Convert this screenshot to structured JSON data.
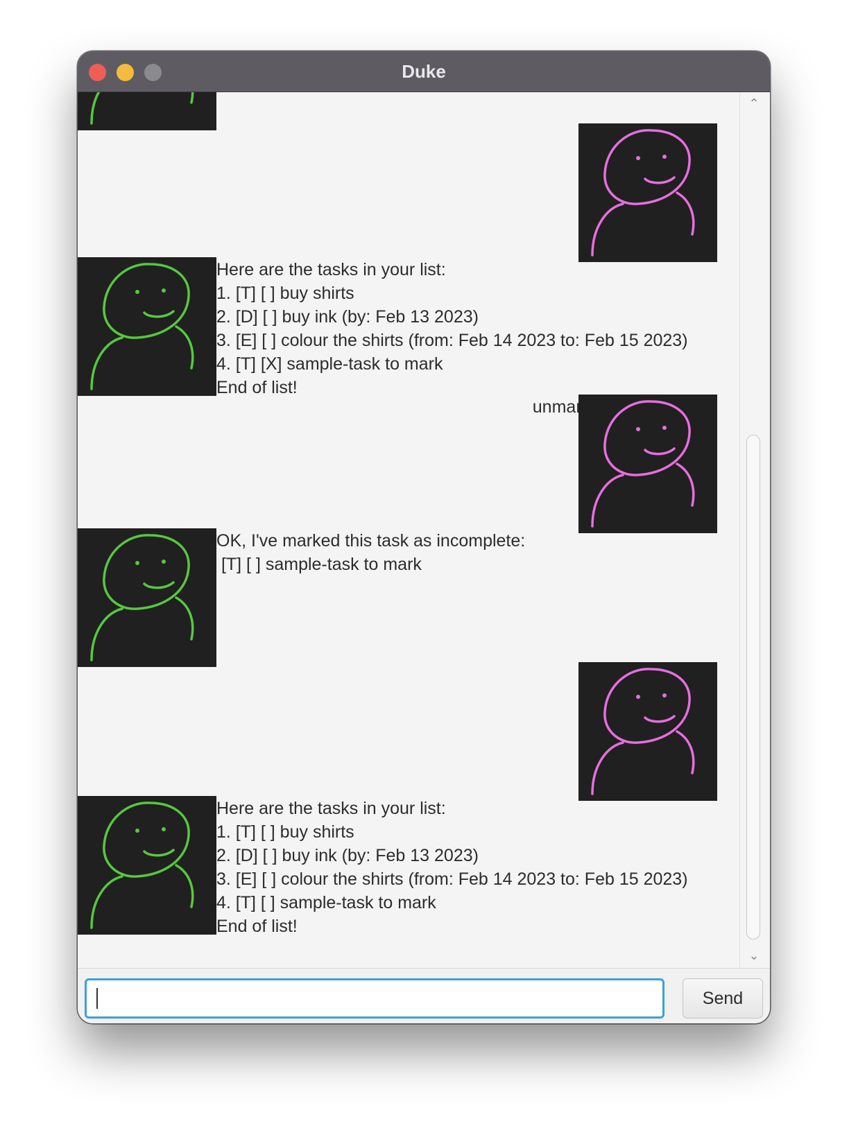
{
  "window": {
    "title": "Duke"
  },
  "dialog": [
    {
      "speaker": "duke",
      "avatar_label": "DUKE",
      "lines": []
    },
    {
      "speaker": "user",
      "avatar_label": "USER",
      "lines": [
        "list"
      ]
    },
    {
      "speaker": "duke",
      "avatar_label": "DUKE",
      "lines": [
        "Here are the tasks in your list:",
        "1. [T] [ ] buy shirts",
        "2. [D] [ ] buy ink (by: Feb 13 2023)",
        "3. [E] [ ] colour the shirts (from: Feb 14 2023 to: Feb 15 2023)",
        "4. [T] [X] sample-task to mark",
        "End of list!"
      ]
    },
    {
      "speaker": "user",
      "avatar_label": "USER",
      "lines": [
        "unmark 4"
      ]
    },
    {
      "speaker": "duke",
      "avatar_label": "DUKE",
      "lines": [
        "OK, I've marked this task as incomplete:",
        " [T] [ ] sample-task to mark"
      ]
    },
    {
      "speaker": "user",
      "avatar_label": "USER",
      "lines": [
        "list"
      ]
    },
    {
      "speaker": "duke",
      "avatar_label": "DUKE",
      "lines": [
        "Here are the tasks in your list:",
        "1. [T] [ ] buy shirts",
        "2. [D] [ ] buy ink (by: Feb 13 2023)",
        "3. [E] [ ] colour the shirts (from: Feb 14 2023 to: Feb 15 2023)",
        "4. [T] [ ] sample-task to mark",
        "End of list!"
      ]
    }
  ],
  "input": {
    "value": "",
    "send_label": "Send"
  },
  "colors": {
    "duke_avatar_stroke": "#56c93d",
    "user_avatar_stroke": "#e76ee0",
    "avatar_background": "#202020",
    "input_focus": "#3b9fe0"
  }
}
